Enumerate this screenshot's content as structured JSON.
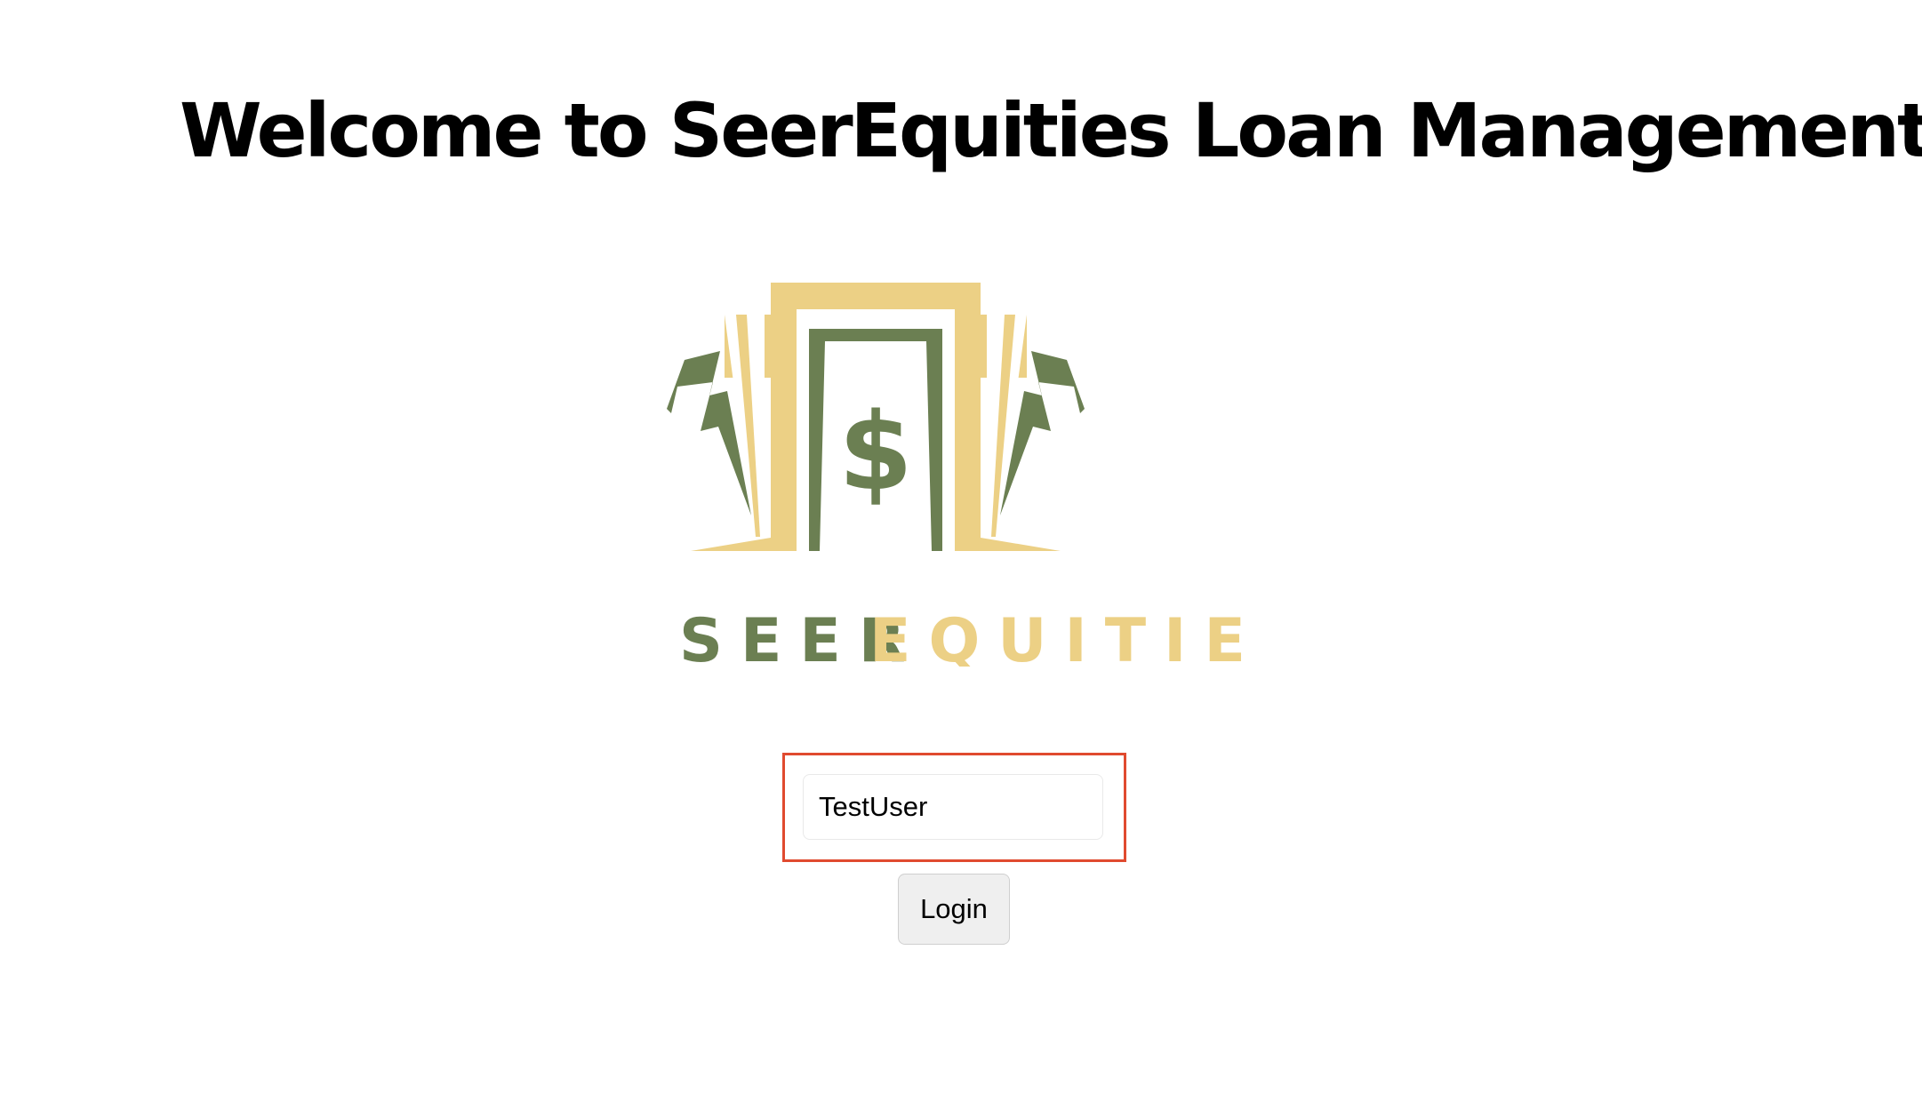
{
  "page": {
    "title": "Welcome to SeerEquities Loan Management"
  },
  "logo": {
    "word_part1": "SEER",
    "word_part2": "EQUITIES",
    "symbol": "$",
    "colors": {
      "gold": "#ecd085",
      "green": "#6b7f52"
    }
  },
  "login": {
    "username_value": "TestUser",
    "button_label": "Login",
    "highlight_color": "#e04a2f"
  }
}
